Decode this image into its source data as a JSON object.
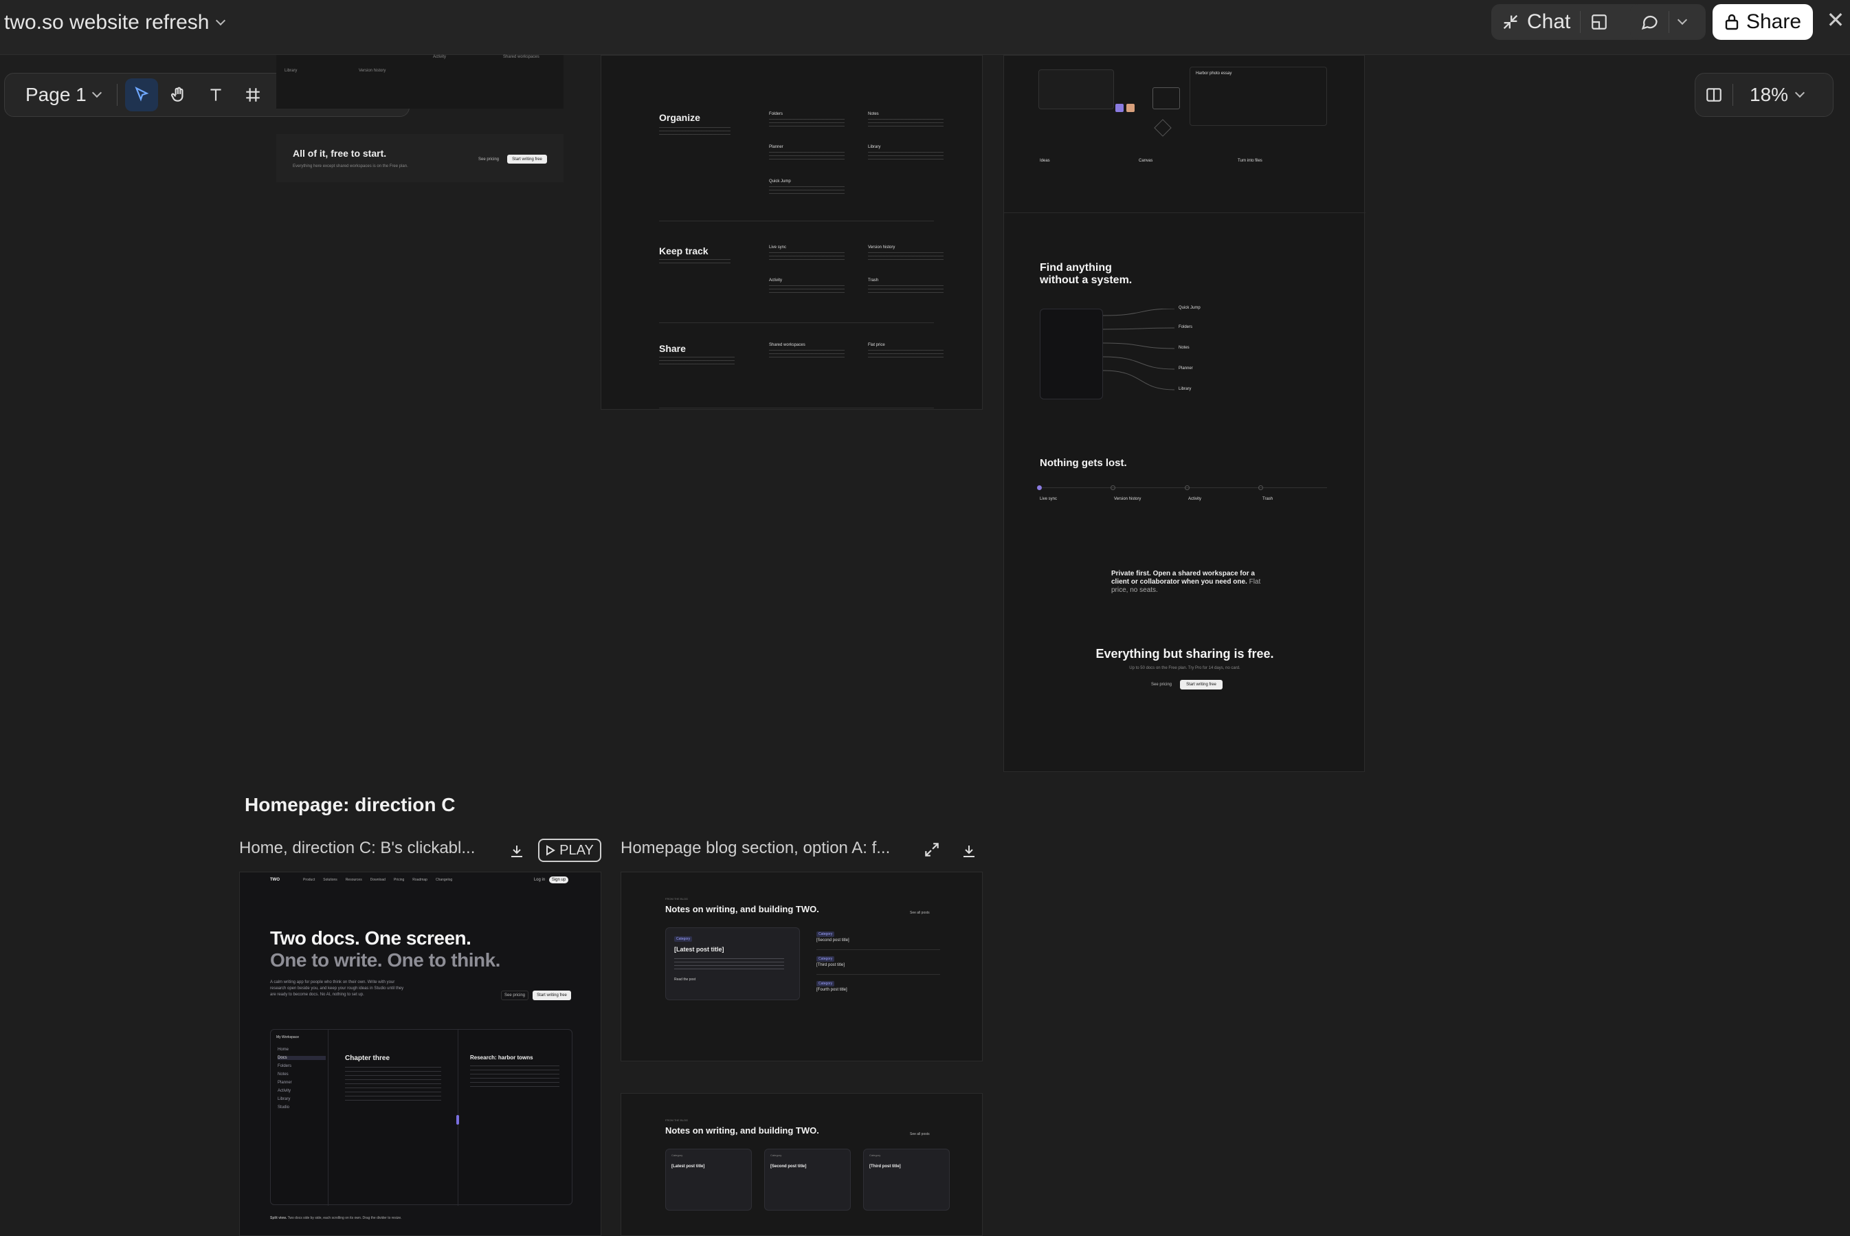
{
  "app": {
    "doc_title": "two.so website refresh",
    "chat_label": "Chat",
    "share_label": "Share",
    "page_label": "Page 1",
    "zoom": "18%"
  },
  "canvas": {
    "section_heading": "Homepage: direction C",
    "cards": [
      {
        "caption": "Home, direction C: B's clickabl...",
        "play_label": "PLAY"
      },
      {
        "caption": "Homepage blog section, option A: f..."
      }
    ],
    "board_a": {
      "cta_title": "All of it, free to start.",
      "cta_sub": "Everything here except shared workspaces is on the Free plan.",
      "see_pricing": "See pricing",
      "start_writing": "Start writing free",
      "mini_items": [
        "Library",
        "Version history",
        "Activity",
        "Shared workspaces"
      ]
    },
    "board_b": {
      "groups": [
        {
          "title": "Organize",
          "desc": "Everything in a few essentials, without building a system first.",
          "items": [
            "Folders",
            "Notes",
            "Planner",
            "Library",
            "Quick Jump"
          ]
        },
        {
          "title": "Keep track",
          "desc": "Nothing gets lost, nothing needs saving.",
          "items": [
            "Live sync",
            "Version history",
            "Activity",
            "Trash"
          ]
        },
        {
          "title": "Share",
          "desc": "TWO is private first. When you need someone else in the room, open a separate space for them.",
          "items": [
            "Shared workspaces",
            "Flat price"
          ]
        }
      ]
    },
    "board_c": {
      "top_items": [
        "Ideas",
        "Canvas",
        "Turn into files"
      ],
      "diagram_note": "Harbor photo essay",
      "find_title_1": "Find anything",
      "find_title_2": "without a system.",
      "find_items": [
        "Quick Jump",
        "Folders",
        "Notes",
        "Planner",
        "Library"
      ],
      "lost_title": "Nothing gets lost.",
      "lost_items": [
        "Live sync",
        "Version history",
        "Activity",
        "Trash"
      ],
      "private_text": "Private first. Open a shared workspace for a client or collaborator when you need one.",
      "private_tail": "Flat price, no seats.",
      "free_title": "Everything but sharing is free.",
      "free_sub": "Up to 50 docs on the Free plan. Try Pro for 14 days, no card.",
      "see_pricing": "See pricing",
      "start_writing": "Start writing free"
    },
    "home_c": {
      "brand": "TWO",
      "nav": [
        "Product",
        "Solutions",
        "Resources",
        "Download",
        "Pricing",
        "Roadmap",
        "Changelog"
      ],
      "log_in": "Log in",
      "sign_up": "Sign up",
      "headline_1": "Two docs. One screen.",
      "headline_2": "One to write. One to think.",
      "lead": "A calm writing app for people who think on their own. Write with your research open beside you, and keep your rough ideas in Studio until they are ready to become docs. No AI, nothing to set up.",
      "see_pricing": "See pricing",
      "start_writing": "Start writing free",
      "workspace": "My Workspace",
      "sidebar": [
        "Home",
        "Docs",
        "Folders",
        "Notes",
        "Planner",
        "Activity",
        "Library",
        "Studio"
      ],
      "doc_title": "Chapter three",
      "research_title": "Research: harbor towns",
      "split_view": "Split view.",
      "split_desc": "Two docs side by side, each scrolling on its own. Drag the divider to resize."
    },
    "blog_a": {
      "kicker": "FROM THE BLOG",
      "title": "Notes on writing, and building TWO.",
      "all_posts": "See all posts",
      "latest": "[Latest post title]",
      "second": "[Second post title]",
      "third": "[Third post title]",
      "fourth": "[Fourth post title]",
      "category": "Category",
      "read_post": "Read the post"
    },
    "blog_b": {
      "kicker": "FROM THE BLOG",
      "title": "Notes on writing, and building TWO.",
      "all_posts": "See all posts",
      "latest": "[Latest post title]",
      "second": "[Second post title]",
      "third": "[Third post title]",
      "category": "Category"
    }
  }
}
